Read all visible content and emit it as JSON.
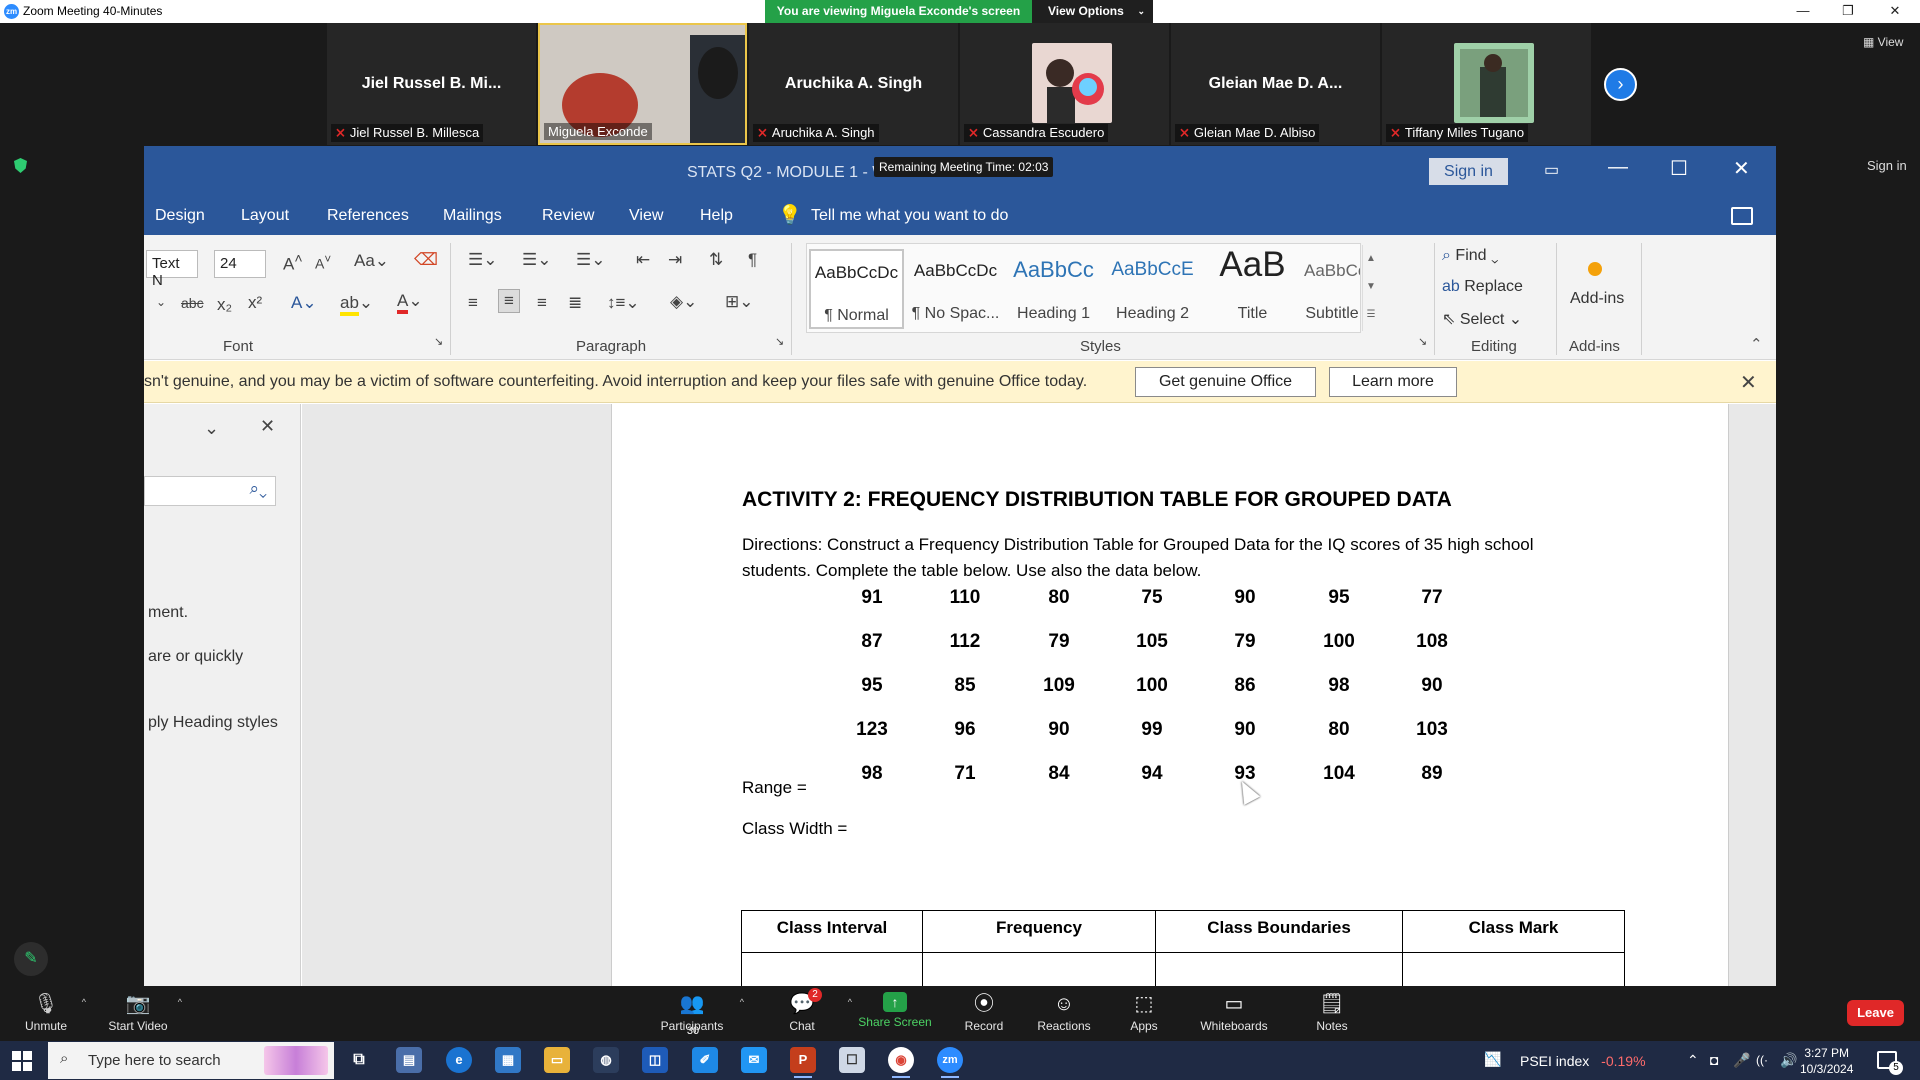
{
  "zoom": {
    "window_title": "Zoom Meeting 40-Minutes",
    "share_banner": "You are viewing Miguela Exconde's screen",
    "view_options": "View Options",
    "view_label": "View",
    "right_signin": "Sign in",
    "participants": [
      {
        "big_name": "Jiel Russel B. Mi...",
        "tag": "Jiel Russel B. Millesca",
        "muted": true,
        "video": false
      },
      {
        "big_name": "",
        "tag": "Miguela Exconde",
        "muted": false,
        "video": true,
        "active": true
      },
      {
        "big_name": "Aruchika A. Singh",
        "tag": "Aruchika A. Singh",
        "muted": true,
        "video": false
      },
      {
        "big_name": "",
        "tag": "Cassandra Escudero",
        "muted": true,
        "video": false,
        "photo": true
      },
      {
        "big_name": "Gleian Mae D. A...",
        "tag": "Gleian Mae D. Albiso",
        "muted": true,
        "video": false
      },
      {
        "big_name": "",
        "tag": "Tiffany Miles Tugano",
        "muted": true,
        "video": false,
        "photo": true
      }
    ],
    "remaining_time": "Remaining Meeting Time: 02:03",
    "toolbar": {
      "unmute": "Unmute",
      "start_video": "Start Video",
      "participants": "Participants",
      "participants_count": "30",
      "chat": "Chat",
      "chat_badge": "2",
      "share_screen": "Share Screen",
      "record": "Record",
      "reactions": "Reactions",
      "apps": "Apps",
      "whiteboards": "Whiteboards",
      "notes": "Notes",
      "leave": "Leave"
    }
  },
  "word": {
    "title": "STATS Q2 - MODULE 1  -  Word",
    "sign_in": "Sign in",
    "menu": [
      "Design",
      "Layout",
      "References",
      "Mailings",
      "Review",
      "View",
      "Help"
    ],
    "tell_me": "Tell me what you want to do",
    "font_name": "Text N",
    "font_size": "24",
    "groups": {
      "font": "Font",
      "paragraph": "Paragraph",
      "styles": "Styles",
      "editing": "Editing",
      "addins": "Add-ins"
    },
    "styles": [
      {
        "preview": "AaBbCcDc",
        "name": "¶ Normal"
      },
      {
        "preview": "AaBbCcDc",
        "name": "¶ No Spac..."
      },
      {
        "preview": "AaBbCc",
        "name": "Heading 1"
      },
      {
        "preview": "AaBbCcE",
        "name": "Heading 2"
      },
      {
        "preview": "AaB",
        "name": "Title"
      },
      {
        "preview": "AaBbCcE",
        "name": "Subtitle"
      }
    ],
    "editing": {
      "find": "Find",
      "replace": "Replace",
      "select": "Select"
    },
    "addins_label": "Add-ins",
    "warning": {
      "message": "sn't genuine, and you may be a victim of software counterfeiting. Avoid interruption and keep your files safe with genuine Office today.",
      "get_genuine": "Get genuine Office",
      "learn_more": "Learn more"
    },
    "nav_pane": {
      "line1": "ment.",
      "line2": "are or quickly",
      "line3": "ply Heading styles"
    },
    "document": {
      "heading": "ACTIVITY 2: FREQUENCY DISTRIBUTION TABLE FOR GROUPED DATA",
      "directions": "Directions: Construct a Frequency Distribution Table for Grouped Data for the IQ scores of 35 high school students. Complete the table below. Use also the data below.",
      "scores": [
        [
          "91",
          "110",
          "80",
          "75",
          "90",
          "95",
          "77"
        ],
        [
          "87",
          "112",
          "79",
          "105",
          "79",
          "100",
          "108"
        ],
        [
          "95",
          "85",
          "109",
          "100",
          "86",
          "98",
          "90"
        ],
        [
          "123",
          "96",
          "90",
          "99",
          "90",
          "80",
          "103"
        ],
        [
          "98",
          "71",
          "84",
          "94",
          "93",
          "104",
          "89"
        ]
      ],
      "range_label": "Range =",
      "class_width_label": "Class Width =",
      "table_headers": [
        "Class Interval",
        "Frequency",
        "Class Boundaries",
        "Class Mark"
      ]
    }
  },
  "taskbar": {
    "search_placeholder": "Type here to search",
    "psei_label": "PSEI index",
    "psei_change": "-0.19%",
    "time": "3:27 PM",
    "date": "10/3/2024"
  }
}
